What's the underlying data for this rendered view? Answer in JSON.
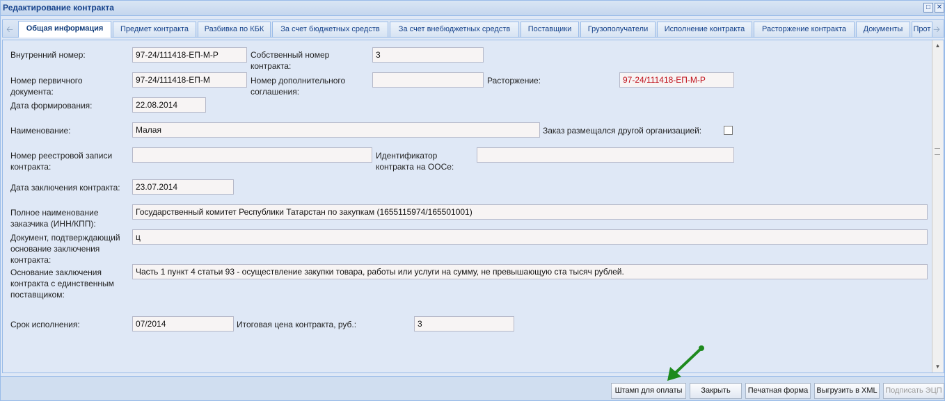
{
  "window": {
    "title": "Редактирование контракта"
  },
  "tabs": [
    "Общая информация",
    "Предмет контракта",
    "Разбивка по КБК",
    "За счет бюджетных средств",
    "За счет внебюджетных средств",
    "Поставщики",
    "Грузополучатели",
    "Исполнение контракта",
    "Расторжение контракта",
    "Документы",
    "Прот"
  ],
  "form": {
    "internal_number": {
      "label": "Внутренний номер:",
      "value": "97-24/111418-ЕП-М-Р"
    },
    "own_number": {
      "label": "Собственный номер контракта:",
      "value": "3"
    },
    "primary_doc_number": {
      "label": "Номер первичного документа:",
      "value": "97-24/111418-ЕП-М"
    },
    "additional_agreement_number": {
      "label": "Номер дополнительного соглашения:",
      "value": ""
    },
    "termination": {
      "label": "Расторжение:",
      "value": "97-24/111418-ЕП-М-Р"
    },
    "formation_date": {
      "label": "Дата формирования:",
      "value": "22.08.2014"
    },
    "name": {
      "label": "Наименование:",
      "value": "Малая"
    },
    "placed_by_other": {
      "label": "Заказ размещался другой организацией:",
      "checked": false
    },
    "registry_record_number": {
      "label": "Номер реестровой записи контракта:",
      "value": ""
    },
    "oos_identifier": {
      "label": "Идентификатор контракта на ООСе:",
      "value": ""
    },
    "conclusion_date": {
      "label": "Дата заключения контракта:",
      "value": "23.07.2014"
    },
    "customer_full_name": {
      "label": "Полное наименование заказчика (ИНН/КПП):",
      "value": "Государственный комитет Республики Татарстан по закупкам (1655115974/165501001)"
    },
    "basis_document": {
      "label": "Документ, подтверждающий основание заключения контракта:",
      "value": "ц"
    },
    "single_supplier_basis": {
      "label": "Основание заключения контракта с единственным поставщиком:",
      "value": "Часть 1 пункт 4 статьи 93 - осуществление закупки товара, работы или услуги на сумму, не превышающую ста тысяч рублей."
    },
    "execution_term": {
      "label": "Срок исполнения:",
      "value": "07/2014"
    },
    "total_price": {
      "label": "Итоговая цена контракта, руб.:",
      "value": "3"
    }
  },
  "footer": {
    "stamp_button": "Штамп для оплаты",
    "close_button": "Закрыть",
    "print_button": "Печатная форма",
    "xml_button": "Выгрузить в XML",
    "sign_button": "Подписать ЭЦП"
  },
  "colors": {
    "accent": "#15428b",
    "error_text": "#c0101a",
    "annotation_arrow": "#1e8a1e"
  },
  "icons": [
    "restore-icon",
    "close-icon",
    "scroll-left-icon",
    "scroll-right-icon"
  ]
}
